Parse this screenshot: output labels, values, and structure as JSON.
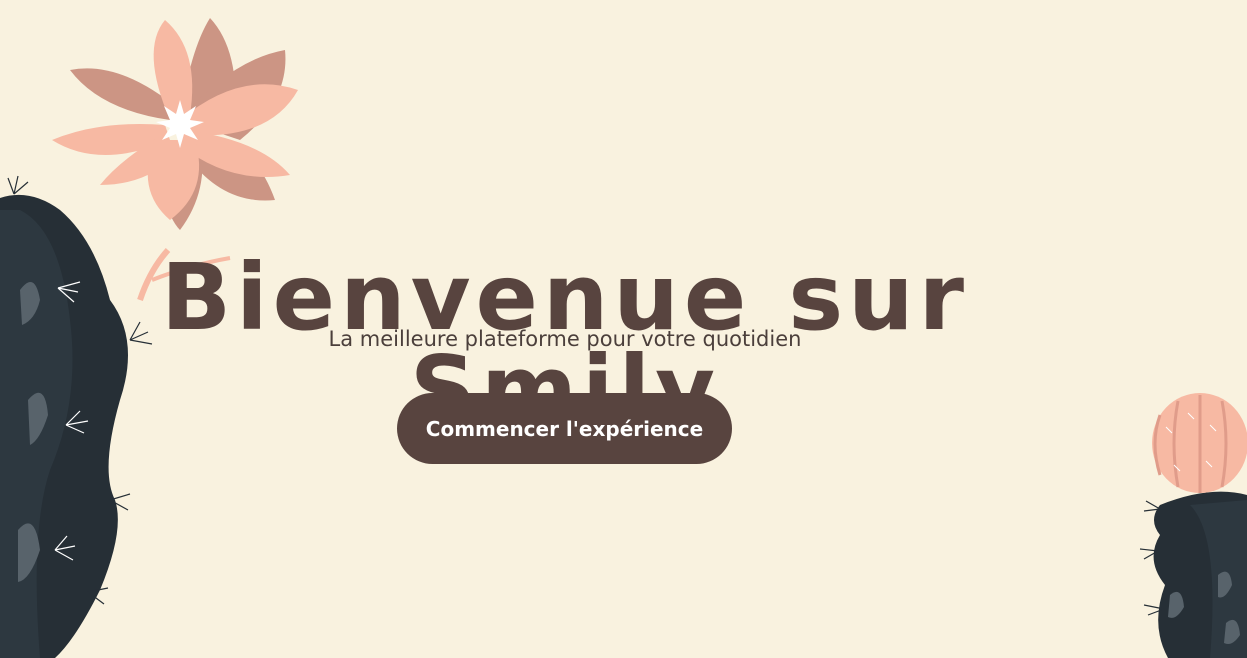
{
  "hero": {
    "title": "Bienvenue sur Smily",
    "subtitle": "La meilleure plateforme pour votre quotidien",
    "cta_label": "Commencer l'expérience"
  },
  "illustrations": {
    "flower": "pink-flower-illustration",
    "cactus_left": "dark-cactus-illustration",
    "cactus_right": "round-cactus-with-pink-flower-illustration"
  },
  "colors": {
    "background": "#f9f2df",
    "text": "#58443f",
    "button": "#58443f",
    "button_text": "#ffffff",
    "petal": "#f7b9a3",
    "petal_dark": "#cc9584",
    "cactus": "#262f36"
  }
}
